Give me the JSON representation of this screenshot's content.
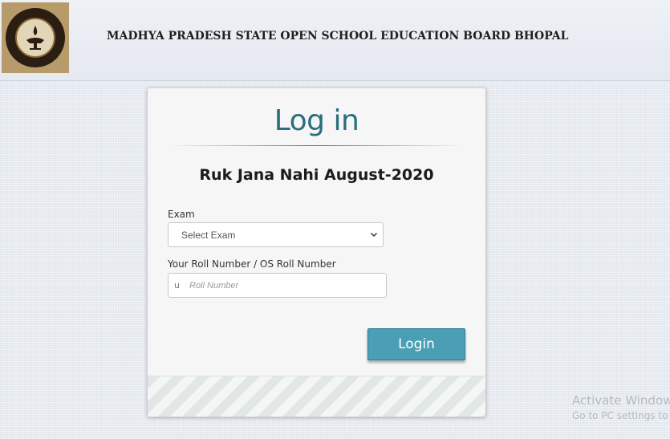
{
  "header": {
    "title": "MADHYA PRADESH STATE OPEN SCHOOL EDUCATION BOARD BHOPAL",
    "logo_icon": "emblem-icon"
  },
  "login_card": {
    "title": "Log in",
    "subtitle": "Ruk Jana Nahi August-2020",
    "exam_label": "Exam",
    "exam_select": {
      "selected": "Select Exam",
      "icon": "chevron-down-icon"
    },
    "roll_label": "Your Roll Number / OS Roll Number",
    "roll_input": {
      "icon_glyph": "u",
      "value": "",
      "placeholder": "Roll Number"
    },
    "login_button": "Login"
  },
  "watermark": {
    "title": "Activate Window",
    "subtitle": "Go to PC settings to a"
  },
  "colors": {
    "accent": "#2b6e7d",
    "button": "#4a9fb4",
    "background": "#e8ecf2"
  }
}
